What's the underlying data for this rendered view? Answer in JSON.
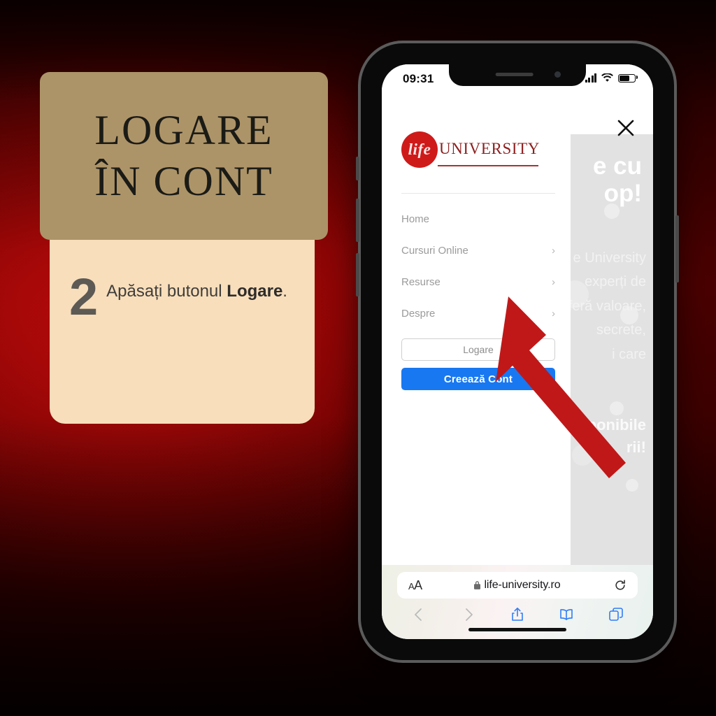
{
  "background": {
    "color": "#8d0707"
  },
  "instruction_card": {
    "title_lines": [
      "LOGARE",
      "ÎN CONT"
    ],
    "step_number": "2",
    "step_text_prefix": "Apăsați butonul ",
    "step_text_bold": "Logare",
    "step_text_suffix": ".",
    "title_bg": "#ad9468",
    "body_bg": "#f8debb"
  },
  "phone": {
    "status_bar": {
      "time": "09:31",
      "cellular_icon": "signal-bars-icon",
      "wifi_icon": "wifi-icon",
      "battery_icon": "battery-icon"
    },
    "menu": {
      "logo": {
        "mark_text": "life",
        "word_text": "UNIVERSITY",
        "mark_color": "#cf1a1a",
        "word_color": "#8e2020"
      },
      "items": [
        {
          "label": "Home",
          "chevron": ""
        },
        {
          "label": "Cursuri Online",
          "chevron": "›"
        },
        {
          "label": "Resurse",
          "chevron": "›"
        },
        {
          "label": "Despre",
          "chevron": "›"
        }
      ],
      "login_button": "Logare",
      "signup_button": "Creează Cont",
      "signup_color": "#1878f2"
    },
    "page_behind": {
      "close_icon": "close-icon",
      "heading": "e cu\nop!",
      "heading_line1": "e cu",
      "heading_line2": "op!",
      "body_line1": "e University",
      "body_line2": "experți de",
      "body_line3": "feră valoare,",
      "body_line4": "secrete,",
      "body_line5": "i care",
      "footer_line1": "sponibile",
      "footer_line2": "rii!"
    },
    "browser": {
      "text_size_button": "AA",
      "lock_icon": "lock-icon",
      "url": "life-university.ro",
      "reload_icon": "reload-icon",
      "back_icon": "chevron-left-icon",
      "forward_icon": "chevron-right-icon",
      "share_icon": "share-icon",
      "bookmarks_icon": "book-icon",
      "tabs_icon": "tabs-icon"
    }
  },
  "annotation_arrow": {
    "name": "pointer-arrow",
    "color": "#c01818",
    "points_to": "Logare"
  }
}
